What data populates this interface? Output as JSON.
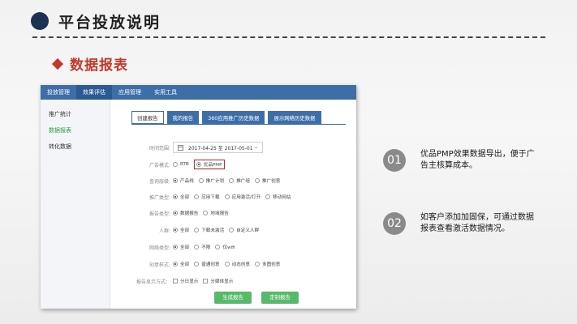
{
  "header": {
    "title": "平台投放说明",
    "subtitle": "数据报表"
  },
  "app": {
    "topnav": [
      "投放管理",
      "效果评估",
      "应用管理",
      "实用工具"
    ],
    "topnav_active": 1,
    "sidebar": [
      "推广统计",
      "数据报表",
      "转化数据"
    ],
    "sidebar_active": 1,
    "tabs": [
      "创建报告",
      "我的报告",
      "360应用推广历史数据",
      "展示网络历史数据"
    ],
    "form": {
      "time_label": "时间范围:",
      "date_range": "2017-04-25 至 2017-05-01",
      "ad_mode_label": "广告模式:",
      "ad_mode_options": [
        "RTB",
        "优品PMP"
      ],
      "query_level_label": "查询层级:",
      "query_level_options": [
        "产品线",
        "推广计划",
        "推广组",
        "推广创意"
      ],
      "promo_type_label": "推广类型:",
      "promo_type_options": [
        "全部",
        "应用下载",
        "应用激活/打开",
        "移动网站"
      ],
      "report_type_label": "报告类型:",
      "report_type_options": [
        "数据报告",
        "地域报告"
      ],
      "crowd_label": "人群:",
      "crowd_options": [
        "全部",
        "下载未激活",
        "自定义人群"
      ],
      "network_label": "网络类型:",
      "network_options": [
        "全部",
        "不限",
        "仅wifi"
      ],
      "creative_label": "创意样式:",
      "creative_options": [
        "全部",
        "普通创意",
        "动态创意",
        "多图创意"
      ],
      "display_label": "报告显示方式：",
      "display_options": [
        "分日显示",
        "分媒体显示"
      ],
      "btn_generate": "生成报告",
      "btn_custom": "定制报告"
    }
  },
  "notes": [
    {
      "num": "01",
      "text": "优品PMP效果数据导出，便于广告主核算成本。"
    },
    {
      "num": "02",
      "text": "如客户添加加固保，可通过数据报表查看激活数据情况。"
    }
  ]
}
